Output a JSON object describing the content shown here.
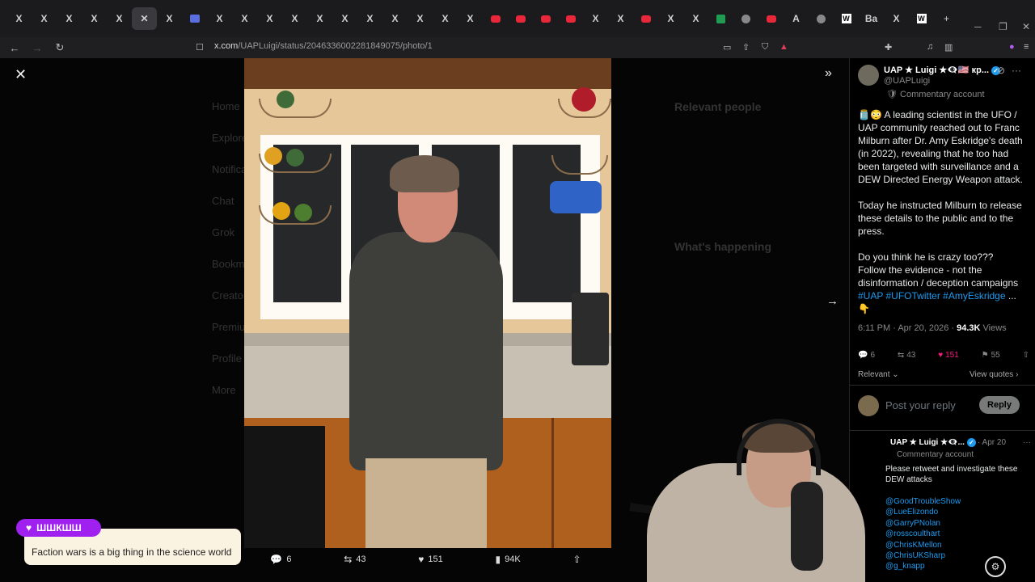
{
  "browser": {
    "url_domain": "x.com",
    "url_path": "/UAPLuigi/status/2046336002281849075/photo/1",
    "tabs": [
      {
        "icon": "x",
        "label": "X"
      },
      {
        "icon": "x",
        "label": "X"
      },
      {
        "icon": "x",
        "label": "X"
      },
      {
        "icon": "x",
        "label": "X"
      },
      {
        "icon": "x",
        "label": "X"
      },
      {
        "icon": "close",
        "label": "✕",
        "active": true
      },
      {
        "icon": "x",
        "label": "X"
      },
      {
        "icon": "blue",
        "label": ""
      },
      {
        "icon": "x",
        "label": "X"
      },
      {
        "icon": "x",
        "label": "X"
      },
      {
        "icon": "x",
        "label": "X"
      },
      {
        "icon": "x",
        "label": "X"
      },
      {
        "icon": "x",
        "label": "X"
      },
      {
        "icon": "x",
        "label": "X"
      },
      {
        "icon": "x",
        "label": "X"
      },
      {
        "icon": "x",
        "label": "X"
      },
      {
        "icon": "x",
        "label": "X"
      },
      {
        "icon": "x",
        "label": "X"
      },
      {
        "icon": "x",
        "label": "X"
      },
      {
        "icon": "yt",
        "label": ""
      },
      {
        "icon": "yt",
        "label": ""
      },
      {
        "icon": "yt",
        "label": ""
      },
      {
        "icon": "yt",
        "label": ""
      },
      {
        "icon": "x",
        "label": "X"
      },
      {
        "icon": "x",
        "label": "X"
      },
      {
        "icon": "yt",
        "label": ""
      },
      {
        "icon": "x",
        "label": "X"
      },
      {
        "icon": "x",
        "label": "X"
      },
      {
        "icon": "grn",
        "label": ""
      },
      {
        "icon": "gry",
        "label": ""
      },
      {
        "icon": "yt",
        "label": ""
      },
      {
        "icon": "x",
        "label": "A"
      },
      {
        "icon": "gry",
        "label": ""
      },
      {
        "icon": "w",
        "label": "W"
      },
      {
        "icon": "x",
        "label": "Ba"
      },
      {
        "icon": "x",
        "label": "X"
      },
      {
        "icon": "w",
        "label": "W"
      }
    ],
    "new_tab_label": "+"
  },
  "viewer": {
    "close_icon": "✕",
    "expand_icon": "»",
    "next_icon": "→",
    "ghost_nav": [
      "Home",
      "Explore",
      "Notifications",
      "Chat",
      "Grok",
      "Bookmarks",
      "Creator Studio",
      "Premium",
      "Profile",
      "More"
    ],
    "ghost_headings": [
      "Relevant people",
      "What's happening"
    ],
    "photo_actions": [
      {
        "name": "reply",
        "icon": "💬",
        "count": "6"
      },
      {
        "name": "retweet",
        "icon": "⇆",
        "count": "43"
      },
      {
        "name": "like",
        "icon": "♥",
        "count": "151"
      },
      {
        "name": "views",
        "icon": "▮",
        "count": "94K"
      },
      {
        "name": "share",
        "icon": "⇧",
        "count": ""
      }
    ]
  },
  "chat": {
    "badge_name": "ШШКШШ",
    "message": "Faction wars is a big thing in the science world"
  },
  "tweet": {
    "display_name": "UAP ★ Luigi ★👁️‍🗨️🇺🇸 кр...",
    "handle": "@UAPLuigi",
    "account_label": "Commentary account",
    "paragraphs": [
      "🫙😳 A leading scientist in the UFO / UAP community reached out to Franc Milburn after Dr. Amy Eskridge's death (in 2022), revealing that he too had been targeted with surveillance and a DEW Directed Energy Weapon attack.",
      "Today he instructed Milburn to release these details to the public and to the press.",
      "Do you think he is crazy too???\nFollow the evidence - not the disinformation / deception campaigns"
    ],
    "hashtags": [
      "#UAP",
      "#UFOTwitter",
      "#AmyEskridge"
    ],
    "hashtag_tail": "...",
    "last_line": "👇",
    "time": "6:11 PM · Apr 20, 2026 · ",
    "views_count": "94.3K",
    "views_label": " Views",
    "stats": {
      "replies": "6",
      "retweets": "43",
      "likes": "151",
      "bookmarks": "55"
    },
    "relevant_label": "Relevant",
    "view_quotes": "View quotes",
    "reply_placeholder": "Post your reply",
    "reply_button": "Reply"
  },
  "reply_tweet": {
    "name": "UAP ★ Luigi ★👁️‍🗨️...",
    "date": "· Apr 20",
    "account_label": "Commentary account",
    "text": "Please retweet and investigate these DEW attacks",
    "mentions": [
      "@GoodTroubleShow",
      "@LueElizondo",
      "@GarryPNolan",
      "@rosscoulthart",
      "@ChrisKMellon",
      "@ChrisUKSharp",
      "@g_knapp"
    ]
  },
  "colors": {
    "accent": "#1d9bf0",
    "like": "#f91880",
    "chat_badge": "#a020f0"
  }
}
